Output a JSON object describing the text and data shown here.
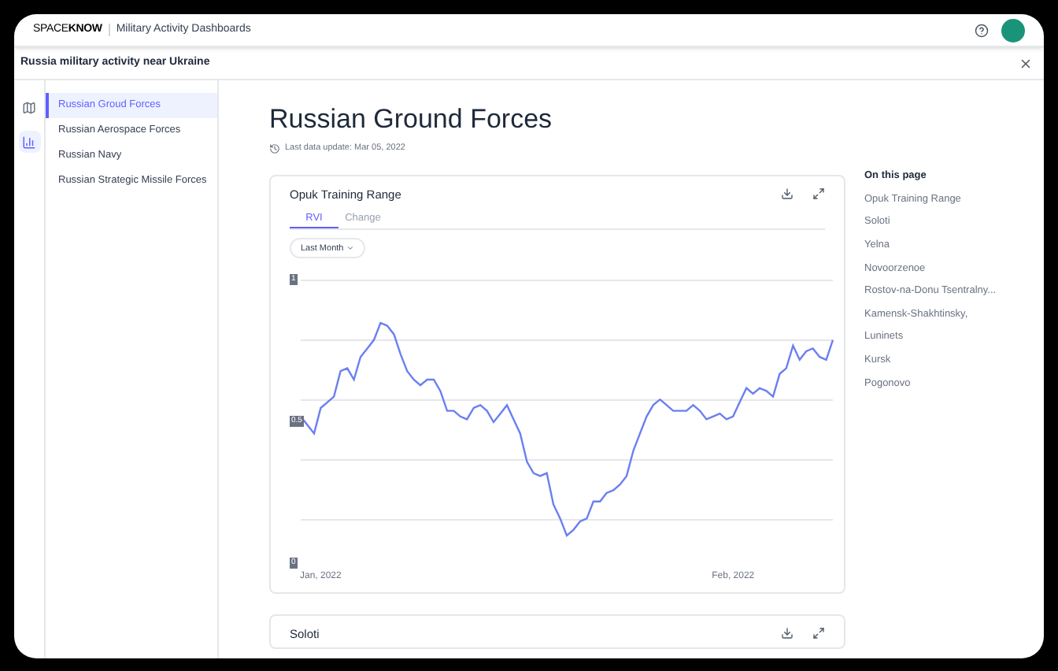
{
  "header": {
    "brand_light": "SPACE",
    "brand_bold": "KNOW",
    "app_title": "Military Activity Dashboards"
  },
  "subheader": {
    "title": "Russia military activity near Ukraine"
  },
  "rail": [
    {
      "selected": false
    },
    {
      "selected": true
    }
  ],
  "sidebar": {
    "items": [
      {
        "label": "Russian Groud Forces",
        "selected": true
      },
      {
        "label": "Russian Aerospace Forces",
        "selected": false
      },
      {
        "label": "Russian Navy",
        "selected": false
      },
      {
        "label": "Russian Strategic Missile Forces",
        "selected": false
      }
    ]
  },
  "page": {
    "title": "Russian Ground Forces",
    "last_update": "Last data update: Mar 05, 2022"
  },
  "cards": [
    {
      "title": "Opuk Training Range",
      "tabs": [
        {
          "label": "RVI",
          "selected": true
        },
        {
          "label": "Change",
          "selected": false
        }
      ],
      "range": "Last Month",
      "chart_data": {
        "type": "line",
        "ylim": [
          0,
          1
        ],
        "yticks": [
          0,
          0.5,
          1
        ],
        "categories": [
          null,
          null,
          null,
          "Jan, 2022",
          null,
          null,
          null,
          null,
          null,
          null,
          null,
          null,
          null,
          null,
          null,
          null,
          null,
          null,
          null,
          null,
          null,
          null,
          null,
          null,
          null,
          null,
          null,
          null,
          null,
          null,
          null,
          null,
          null,
          null,
          null,
          null,
          null,
          null,
          null,
          null,
          null,
          null,
          null,
          null,
          null,
          null,
          null,
          null,
          null,
          null,
          null,
          null,
          null,
          null,
          null,
          null,
          null,
          null,
          null,
          null,
          null,
          null,
          null,
          null,
          null,
          "Feb, 2022",
          null,
          null,
          null,
          null,
          null,
          null,
          null,
          null,
          null,
          null,
          null,
          null,
          null,
          null,
          null
        ],
        "series": [
          {
            "color": "#6b7ff0",
            "values": [
              0.52,
              0.49,
              0.46,
              0.55,
              0.57,
              0.59,
              0.68,
              0.69,
              0.65,
              0.73,
              0.76,
              0.79,
              0.85,
              0.84,
              0.81,
              0.74,
              0.68,
              0.65,
              0.63,
              0.65,
              0.65,
              0.61,
              0.54,
              0.54,
              0.52,
              0.51,
              0.55,
              0.56,
              0.54,
              0.5,
              0.53,
              0.56,
              0.51,
              0.46,
              0.36,
              0.32,
              0.31,
              0.32,
              0.21,
              0.16,
              0.1,
              0.12,
              0.15,
              0.16,
              0.22,
              0.22,
              0.25,
              0.26,
              0.28,
              0.31,
              0.4,
              0.46,
              0.52,
              0.56,
              0.58,
              0.56,
              0.54,
              0.54,
              0.54,
              0.56,
              0.54,
              0.51,
              0.52,
              0.53,
              0.51,
              0.52,
              0.57,
              0.62,
              0.6,
              0.62,
              0.61,
              0.59,
              0.67,
              0.69,
              0.77,
              0.72,
              0.75,
              0.76,
              0.73,
              0.72,
              0.79
            ]
          }
        ]
      }
    },
    {
      "title": "Soloti"
    }
  ],
  "on_this_page": {
    "heading": "On this page",
    "items": [
      "Opuk Training Range",
      "Soloti",
      "Yelna",
      "Novoorzenoe",
      "Rostov-na-Donu Tsentralny...",
      "Kamensk-Shakhtinsky,",
      "Luninets",
      "Kursk",
      "Pogonovo"
    ]
  }
}
